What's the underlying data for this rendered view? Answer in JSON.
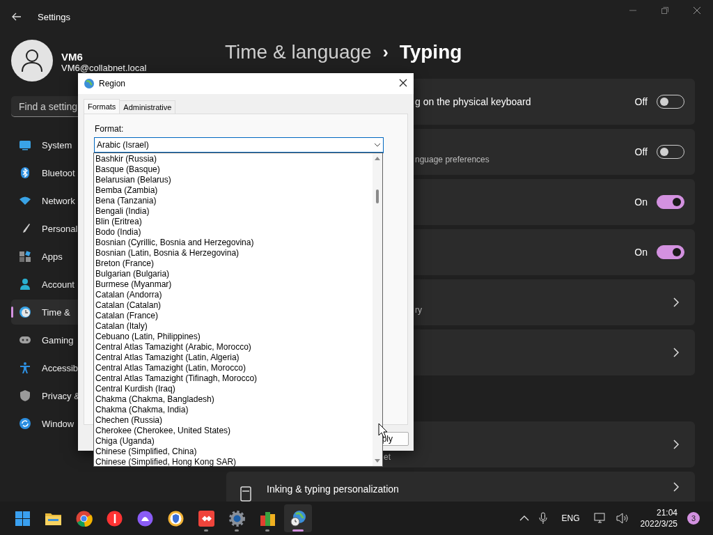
{
  "window": {
    "title": "Settings"
  },
  "profile": {
    "name": "VM6",
    "email": "VM6@collabnet.local"
  },
  "search": {
    "placeholder": "Find a setting"
  },
  "nav": [
    {
      "label": "System",
      "selected": false
    },
    {
      "label": "Bluetoot",
      "selected": false
    },
    {
      "label": "Network",
      "selected": false
    },
    {
      "label": "Personal",
      "selected": false
    },
    {
      "label": "Apps",
      "selected": false
    },
    {
      "label": "Account",
      "selected": false
    },
    {
      "label": "Time &",
      "selected": true
    },
    {
      "label": "Gaming",
      "selected": false
    },
    {
      "label": "Accessib",
      "selected": false
    },
    {
      "label": "Privacy &",
      "selected": false
    },
    {
      "label": "Window",
      "selected": false
    }
  ],
  "breadcrumb": {
    "parent": "Time & language",
    "separator": "›",
    "current": "Typing"
  },
  "cards": [
    {
      "kind": "toggle",
      "title": "g on the physical keyboard",
      "state_label": "Off",
      "on": false
    },
    {
      "kind": "toggle",
      "subtitle": "nguage preferences",
      "state_label": "Off",
      "on": false
    },
    {
      "kind": "toggle",
      "state_label": "On",
      "on": true
    },
    {
      "kind": "toggle",
      "state_label": "On",
      "on": true
    },
    {
      "kind": "link",
      "subtitle": "ry"
    },
    {
      "kind": "link"
    },
    {
      "kind": "link",
      "subtitle": "et",
      "group_start": true
    },
    {
      "kind": "link",
      "title": "Inking & typing personalization"
    }
  ],
  "dialog": {
    "title": "Region",
    "tabs": [
      {
        "label": "Formats",
        "selected": true
      },
      {
        "label": "Administrative",
        "selected": false
      }
    ],
    "format_label": "Format:",
    "format_value": "Arabic (Israel)",
    "options": [
      "Bashkir (Russia)",
      "Basque (Basque)",
      "Belarusian (Belarus)",
      "Bemba (Zambia)",
      "Bena (Tanzania)",
      "Bengali (India)",
      "Blin (Eritrea)",
      "Bodo (India)",
      "Bosnian (Cyrillic, Bosnia and Herzegovina)",
      "Bosnian (Latin, Bosnia & Herzegovina)",
      "Breton (France)",
      "Bulgarian (Bulgaria)",
      "Burmese (Myanmar)",
      "Catalan (Andorra)",
      "Catalan (Catalan)",
      "Catalan (France)",
      "Catalan (Italy)",
      "Cebuano (Latin, Philippines)",
      "Central Atlas Tamazight (Arabic, Morocco)",
      "Central Atlas Tamazight (Latin, Algeria)",
      "Central Atlas Tamazight (Latin, Morocco)",
      "Central Atlas Tamazight (Tifinagh, Morocco)",
      "Central Kurdish (Iraq)",
      "Chakma (Chakma, Bangladesh)",
      "Chakma (Chakma, India)",
      "Chechen (Russia)",
      "Cherokee (Cherokee, United States)",
      "Chiga (Uganda)",
      "Chinese (Simplified, China)",
      "Chinese (Simplified, Hong Kong SAR)"
    ],
    "apply_button": "ply"
  },
  "taskbar": {
    "apps": [
      {
        "running": false,
        "active": false
      },
      {
        "running": false,
        "active": false
      },
      {
        "running": false,
        "active": false
      },
      {
        "running": false,
        "active": false
      },
      {
        "running": false,
        "active": false
      },
      {
        "running": false,
        "active": false
      },
      {
        "running": true,
        "active": false
      },
      {
        "running": true,
        "active": false
      },
      {
        "running": true,
        "active": false
      },
      {
        "running": true,
        "active": true
      }
    ],
    "language": "ENG",
    "time": "21:04",
    "date": "2022/3/25",
    "notifications": "3"
  }
}
